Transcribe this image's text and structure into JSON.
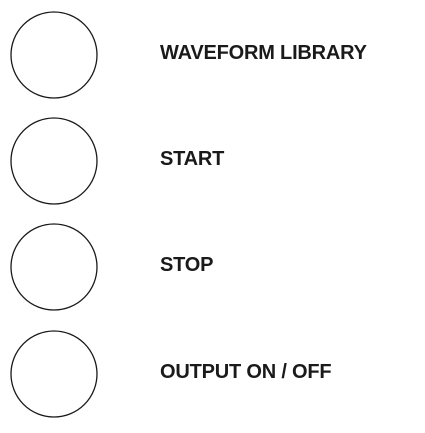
{
  "buttons": [
    {
      "label": "WAVEFORM LIBRARY"
    },
    {
      "label": "START"
    },
    {
      "label": "STOP"
    },
    {
      "label": "OUTPUT ON / OFF"
    }
  ],
  "colors": {
    "background": "#ffffff",
    "outline": "#1a1a1a",
    "text": "#1a1a1a"
  }
}
